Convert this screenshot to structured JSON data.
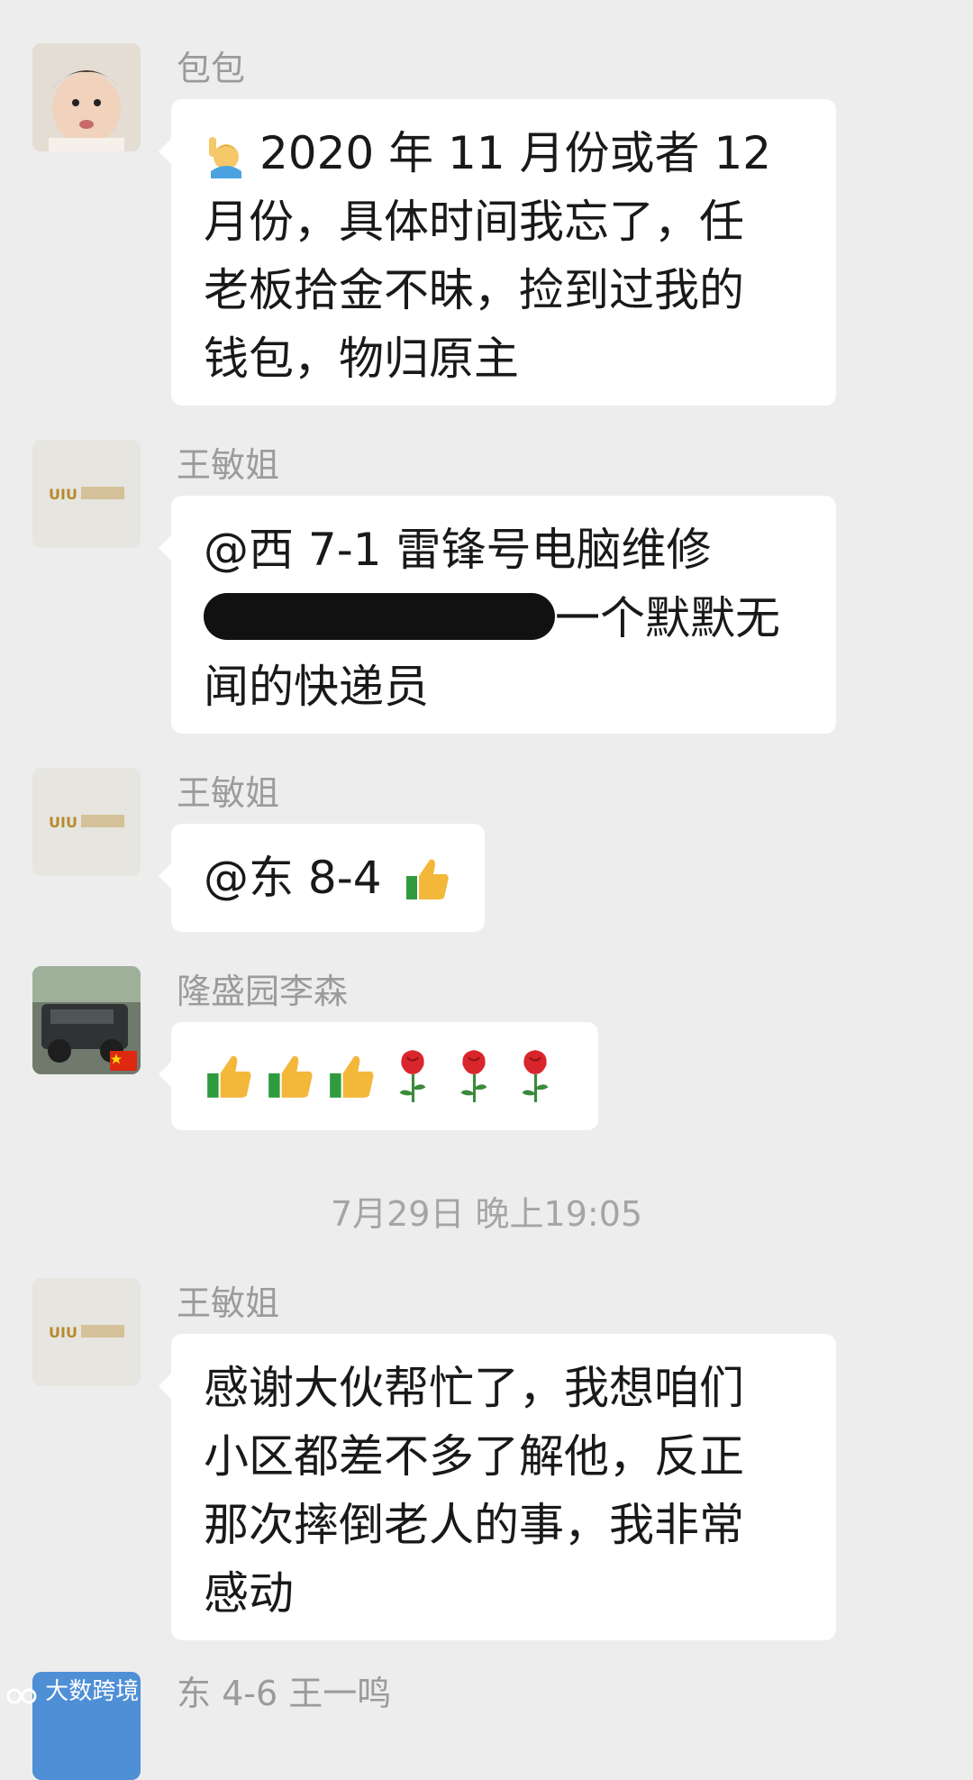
{
  "messages": [
    {
      "sender": "包包",
      "lines": [
        "2020 年 11 月份或者 12",
        "月份，具体时间我忘了，任",
        "老板拾金不昧，捡到过我的",
        "钱包，物归原主"
      ]
    },
    {
      "sender": "王敏姐",
      "lines": [
        "@西 7-1 雷锋号电脑维修",
        "一个默默无",
        "闻的快递员"
      ]
    },
    {
      "sender": "王敏姐",
      "lines": [
        "@东 8-4"
      ]
    },
    {
      "sender": "隆盛园李森",
      "lines": []
    },
    {
      "sender": "王敏姐",
      "lines": [
        "感谢大伙帮忙了，我想咱们",
        "小区都差不多了解他，反正",
        "那次摔倒老人的事，我非常",
        "感动"
      ]
    }
  ],
  "timestamp": "7月29日 晚上19:05",
  "next_message_preview": "东 4-6 王一鸣",
  "watermark": "大数跨境",
  "colors": {
    "background": "#ededed",
    "bubble": "#ffffff",
    "sender": "#9b9b9b",
    "text": "#191919"
  },
  "icons": [
    "person-raising-hand-emoji",
    "thumbs-up-emoji",
    "rose-emoji",
    "china-flag-badge"
  ]
}
